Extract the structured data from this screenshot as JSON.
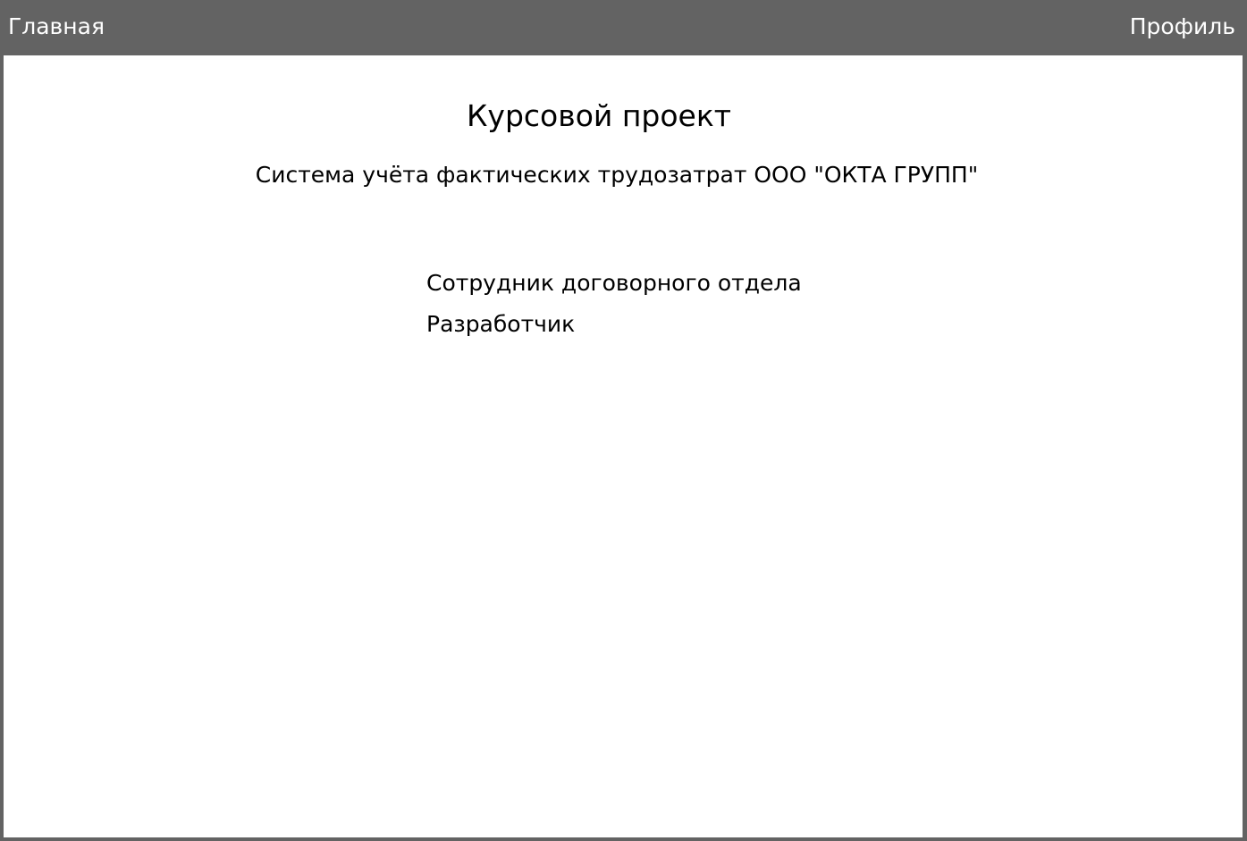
{
  "nav": {
    "home_label": "Главная",
    "profile_label": "Профиль"
  },
  "main": {
    "title": "Курсовой проект",
    "subtitle": "Система учёта фактических трудозатрат ООО \"ОКТА ГРУПП\"",
    "roles": [
      "Сотрудник договорного отдела",
      "Разработчик"
    ]
  },
  "colors": {
    "topbar": "#636363",
    "content_background": "#ffffff",
    "nav_text": "#ffffff",
    "body_text": "#000000"
  }
}
